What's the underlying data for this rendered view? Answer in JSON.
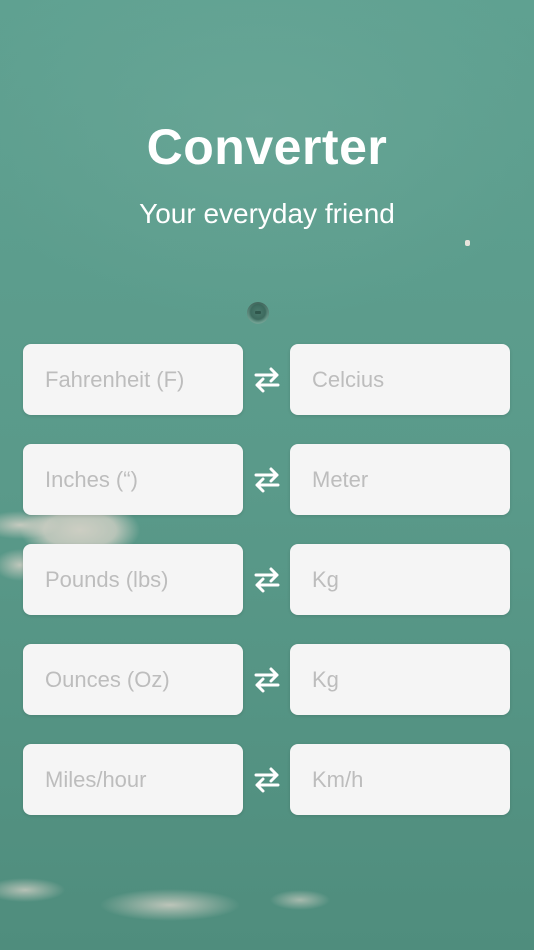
{
  "header": {
    "title": "Converter",
    "subtitle": "Your everyday friend"
  },
  "conversions": [
    {
      "from_placeholder": "Fahrenheit (F)",
      "to_placeholder": "Celcius",
      "swap_icon": "swap-arrows-icon"
    },
    {
      "from_placeholder": "Inches (“)",
      "to_placeholder": "Meter",
      "swap_icon": "swap-arrows-icon"
    },
    {
      "from_placeholder": "Pounds (lbs)",
      "to_placeholder": "Kg",
      "swap_icon": "swap-arrows-icon"
    },
    {
      "from_placeholder": "Ounces (Oz)",
      "to_placeholder": "Kg",
      "swap_icon": "swap-arrows-icon"
    },
    {
      "from_placeholder": "Miles/hour",
      "to_placeholder": "Km/h",
      "swap_icon": "swap-arrows-icon"
    }
  ],
  "colors": {
    "background": "#5e9e8e",
    "field_background": "#f5f5f5",
    "placeholder": "#bdbdbd",
    "text": "#ffffff"
  }
}
